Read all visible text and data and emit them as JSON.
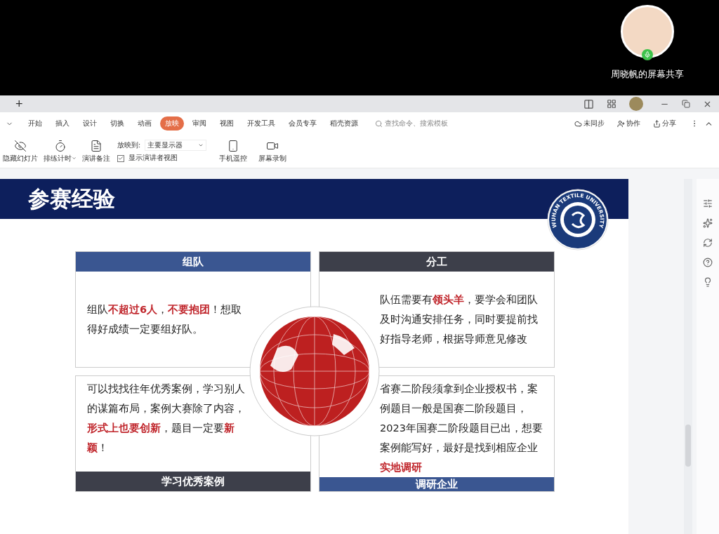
{
  "screen_share": {
    "presenter_label": "周晓帆的屏幕共享",
    "mic_on": true
  },
  "window": {
    "new_tab": "+"
  },
  "ribbon_tabs": [
    {
      "label": "开始",
      "selected": false
    },
    {
      "label": "插入",
      "selected": false
    },
    {
      "label": "设计",
      "selected": false
    },
    {
      "label": "切换",
      "selected": false
    },
    {
      "label": "动画",
      "selected": false
    },
    {
      "label": "放映",
      "selected": true
    },
    {
      "label": "审阅",
      "selected": false
    },
    {
      "label": "视图",
      "selected": false
    },
    {
      "label": "开发工具",
      "selected": false
    },
    {
      "label": "会员专享",
      "selected": false
    },
    {
      "label": "稻壳资源",
      "selected": false
    }
  ],
  "search": {
    "placeholder": "查找命令、搜索模板"
  },
  "ribbon_actions": [
    {
      "kind": "sync",
      "label": "未同步"
    },
    {
      "kind": "collab",
      "label": "协作"
    },
    {
      "kind": "share",
      "label": "分享"
    }
  ],
  "toolbar": {
    "buttons": [
      {
        "kind": "hide",
        "label": "隐藏幻灯片",
        "dropdown": false
      },
      {
        "kind": "timer",
        "label": "排练计时",
        "dropdown": true
      },
      {
        "kind": "notes",
        "label": "演讲备注",
        "dropdown": false
      }
    ],
    "play_to": {
      "label": "放映到:",
      "value": "主要显示器"
    },
    "presenter_view": {
      "label": "显示演讲者视图",
      "checked": true
    },
    "buttons_right": [
      {
        "kind": "phone",
        "label": "手机遥控"
      },
      {
        "kind": "record",
        "label": "屏幕录制"
      }
    ]
  },
  "slide": {
    "title": "参赛经验",
    "logo_text": "WUHAN TEXTILE UNIVERSITY",
    "cards": [
      {
        "heading": "组队",
        "color": "#3a5691",
        "text": "组队**不超过6人**，**不要抱团**！想取得好成绩一定要组好队。"
      },
      {
        "heading": "分工",
        "color": "#3d3f4a",
        "text": "队伍需要有**领头羊**，要学会和团队及时沟通安排任务，同时要提前找好指导老师，根据导师意见修改"
      },
      {
        "heading": "学习优秀案例",
        "color": "#3d3f4a",
        "text": "可以找找往年优秀案例，学习别人的谋篇布局，案例大赛除了内容，**形式上也要创新**，题目一定要**新颖**！"
      },
      {
        "heading": "调研企业",
        "color": "#3a5691",
        "text": "省赛二阶段须拿到企业授权书，案例题目一般是国赛二阶段题目，2023年国赛二阶段题目已出，想要案例能写好，最好是找到相应企业**实地调研**"
      }
    ]
  }
}
